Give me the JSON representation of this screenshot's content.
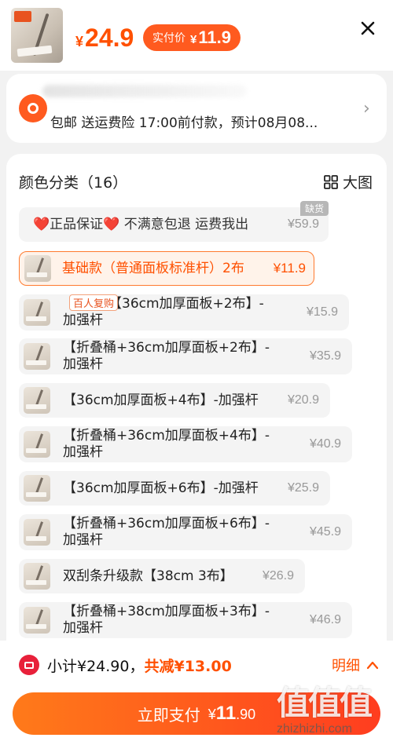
{
  "header": {
    "price_symbol": "¥",
    "price": "24.9",
    "actual_label": "实付价",
    "actual_symbol": "¥",
    "actual_price": "11.9",
    "product_thumb_icon": "mop-product-thumbnail",
    "close_icon": "close-icon"
  },
  "shipping": {
    "text": "包邮 送运费险 17:00前付款，预计08月08...",
    "icon": "location-pin-icon",
    "chevron": "›"
  },
  "options": {
    "title": "颜色分类（16）",
    "big_view_label": "大图",
    "items": [
      {
        "name": "❤️正品保证❤️ 不满意包退 运费我出",
        "price": "¥59.9",
        "tag": "缺货",
        "has_image": false
      },
      {
        "name": "基础款（普通面板标准杆）2布",
        "price": "¥11.9",
        "selected": true
      },
      {
        "name_line1": "【36cm加厚面板+2布】-",
        "name_line2": "加强杆",
        "price": "¥15.9",
        "tag": "百人复购"
      },
      {
        "name_line1": "【折叠桶+36cm加厚面板+2布】-",
        "name_line2": "加强杆",
        "price": "¥35.9"
      },
      {
        "name": "【36cm加厚面板+4布】-加强杆",
        "price": "¥20.9"
      },
      {
        "name_line1": "【折叠桶+36cm加厚面板+4布】-",
        "name_line2": "加强杆",
        "price": "¥40.9"
      },
      {
        "name": "【36cm加厚面板+6布】-加强杆",
        "price": "¥25.9"
      },
      {
        "name_line1": "【折叠桶+36cm加厚面板+6布】-",
        "name_line2": "加强杆",
        "price": "¥45.9"
      },
      {
        "name": "双刮条升级款【38cm 3布】",
        "price": "¥26.9"
      },
      {
        "name_line1": "【折叠桶+38cm加厚面板+3布】-",
        "name_line2": "加强杆",
        "price": "¥46.9"
      }
    ]
  },
  "footer": {
    "subtotal_label": "小计¥24.90，",
    "discount_label": "共减¥13.00",
    "detail_label": "明细",
    "pay_label": "立即支付",
    "pay_symbol": "¥",
    "pay_amount_int": "11",
    "pay_amount_dec": ".90"
  },
  "watermark": {
    "text": "值值值",
    "url": "zhizhizhi.com"
  },
  "colors": {
    "accent": "#ff5000",
    "pill": "#ff5a1f",
    "subtotal_icon": "#e8203a"
  }
}
